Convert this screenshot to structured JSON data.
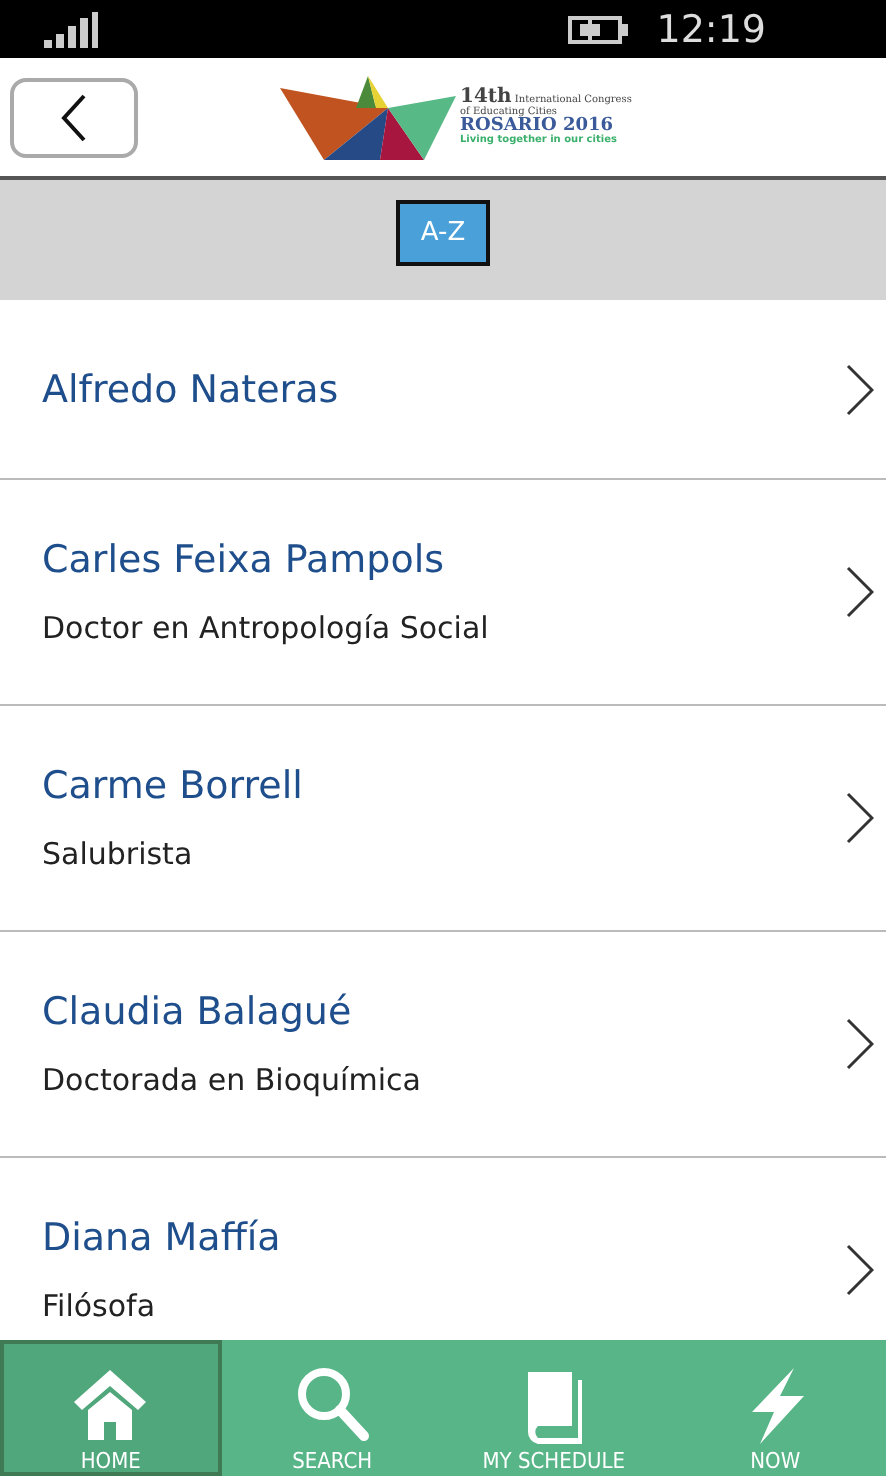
{
  "status_bar": {
    "time": "12:19"
  },
  "header": {
    "logo": {
      "edition": "14th",
      "title_rest": "International Congress",
      "title_line2": "of Educating Cities",
      "city": "ROSARIO 2016",
      "motto": "Living together in our cities"
    }
  },
  "filter": {
    "label": "A-Z"
  },
  "speakers": [
    {
      "name": "Alfredo Nateras"
    },
    {
      "name": "Carles Feixa Pampols",
      "title": "Doctor en Antropología Social"
    },
    {
      "name": "Carme Borrell",
      "title": "Salubrista"
    },
    {
      "name": "Claudia Balagué",
      "title": "Doctorada en Bioquímica"
    },
    {
      "name": "Diana Maffía",
      "title": "Filósofa"
    }
  ],
  "nav": [
    {
      "kind": "home",
      "label": "HOME",
      "selected": true
    },
    {
      "kind": "search",
      "label": "SEARCH",
      "selected": false
    },
    {
      "kind": "schedule",
      "label": "MY SCHEDULE",
      "selected": false
    },
    {
      "kind": "now",
      "label": "NOW",
      "selected": false
    }
  ]
}
